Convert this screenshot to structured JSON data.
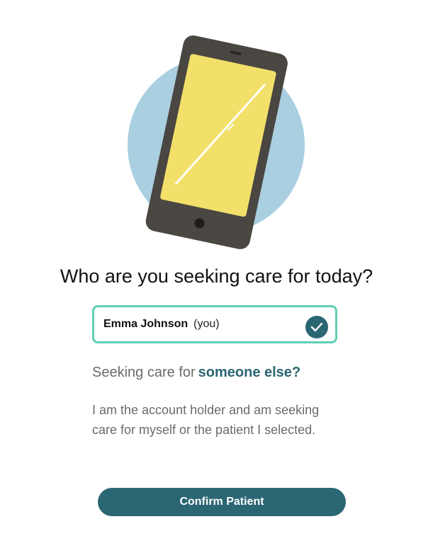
{
  "illustration": {
    "icon": "smartphone-icon",
    "colors": {
      "circle": "#a9cfe0",
      "phone_body": "#4a4642",
      "screen": "#f2e06a",
      "glare": "#ffffff"
    }
  },
  "heading": "Who are you seeking care for today?",
  "patient": {
    "name": "Emma Johnson",
    "relation": "(you)",
    "selected": true,
    "check_icon": "checkmark-icon"
  },
  "someone_else": {
    "prefix": "Seeking care for",
    "link": "someone else?"
  },
  "description": "I am the account holder and am seeking care for myself or the patient I selected.",
  "confirm_button": "Confirm Patient",
  "colors": {
    "accent": "#2b6673",
    "selected_border": "#5fcfb4",
    "muted_text": "#6b6b6b"
  }
}
